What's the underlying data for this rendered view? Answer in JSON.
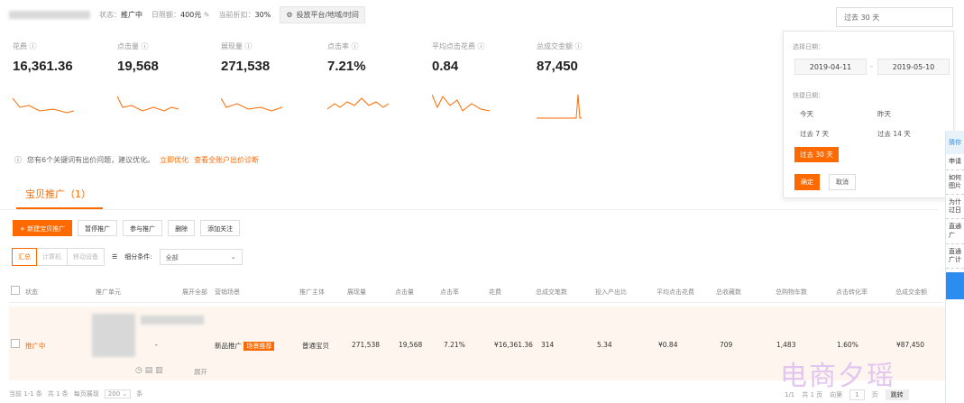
{
  "topbar": {
    "status_label": "状态：",
    "status_value": "推广中",
    "budget_label": "日限额：",
    "budget_value": "400元",
    "discount_label": "当前折扣：",
    "discount_value": "30%",
    "platform_btn": "投放平台/地域/时间"
  },
  "date_select": {
    "value": "过去 30 天"
  },
  "metrics": [
    {
      "label": "花费",
      "value": "16,361.36"
    },
    {
      "label": "点击量",
      "value": "19,568"
    },
    {
      "label": "展现量",
      "value": "271,538"
    },
    {
      "label": "点击率",
      "value": "7.21%"
    },
    {
      "label": "平均点击花费",
      "value": "0.84"
    },
    {
      "label": "总成交金额",
      "value": "87,450"
    }
  ],
  "notice": {
    "text": "您有6个关键词有出价问题，建议优化。",
    "link1": "立即优化",
    "link2": "查看全账户出价诊断"
  },
  "tab": {
    "label": "宝贝推广（1）"
  },
  "toolbar": {
    "new": "+ 新建宝贝推广",
    "pause": "暂停推广",
    "join": "参与推广",
    "delete": "删除",
    "follow": "添加关注"
  },
  "filters": {
    "seg": [
      "汇总",
      "计算机",
      "移动设备"
    ],
    "detail_label": "细分条件:",
    "select_value": "全部"
  },
  "table": {
    "headers": [
      "状态",
      "推广单元",
      "展开全部",
      "营销场景",
      "推广主体",
      "展现量",
      "点击量",
      "点击率",
      "花费",
      "总成交笔数",
      "投入产出比",
      "平均点击花费",
      "总收藏数",
      "总购物车数",
      "点击转化率",
      "总成交金额"
    ],
    "row": {
      "status": "推广中",
      "scene": "新品推广",
      "scene_badge": "场景推荐",
      "subject": "普通宝贝",
      "impressions": "271,538",
      "clicks": "19,568",
      "ctr": "7.21%",
      "cost": "¥16,361.36",
      "orders": "314",
      "roi": "5.34",
      "cpc": "¥0.84",
      "favs": "709",
      "carts": "1,483",
      "cvr": "1.60%",
      "gmv": "¥87,450",
      "expand": "展开",
      "dash": "-"
    }
  },
  "footer": {
    "range": "当前 1-1 条",
    "total": "共 1 条",
    "per_page_label": "每页展现",
    "per_page": "200",
    "unit": "条"
  },
  "pager": {
    "pages": "1/1",
    "total": "共 1 页",
    "to": "向第",
    "page": "1",
    "page_unit": "页",
    "go": "跳转"
  },
  "popover": {
    "select_label": "选择日期：",
    "start": "2019-04-11",
    "sep": "-",
    "end": "2019-05-10",
    "quick_label": "快捷日期：",
    "today": "今天",
    "yesterday": "昨天",
    "past7": "过去 7 天",
    "past14": "过去 14 天",
    "past30": "过去 30 天",
    "ok": "确定",
    "cancel": "取消"
  },
  "help": {
    "header": "猜你",
    "items": [
      "申请",
      "如何图片",
      "为什过日",
      "直通广",
      "直通广计"
    ]
  },
  "watermark": "电商夕瑶"
}
